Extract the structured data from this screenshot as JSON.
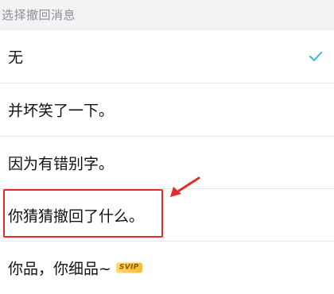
{
  "header": {
    "title": "选择撤回消息"
  },
  "options": [
    {
      "label": "无",
      "selected": true
    },
    {
      "label": "并坏笑了一下。",
      "selected": false
    },
    {
      "label": "因为有错别字。",
      "selected": false
    },
    {
      "label": "你猜猜撤回了什么。",
      "selected": false
    },
    {
      "label": "你品，你细品~",
      "selected": false,
      "badge": "SVIP"
    }
  ],
  "colors": {
    "check": "#3bb6d8",
    "highlight": "#e52a2a",
    "badge": "#f6b93b"
  },
  "icons": {
    "check": "check-icon",
    "arrow": "red-arrow-icon"
  }
}
